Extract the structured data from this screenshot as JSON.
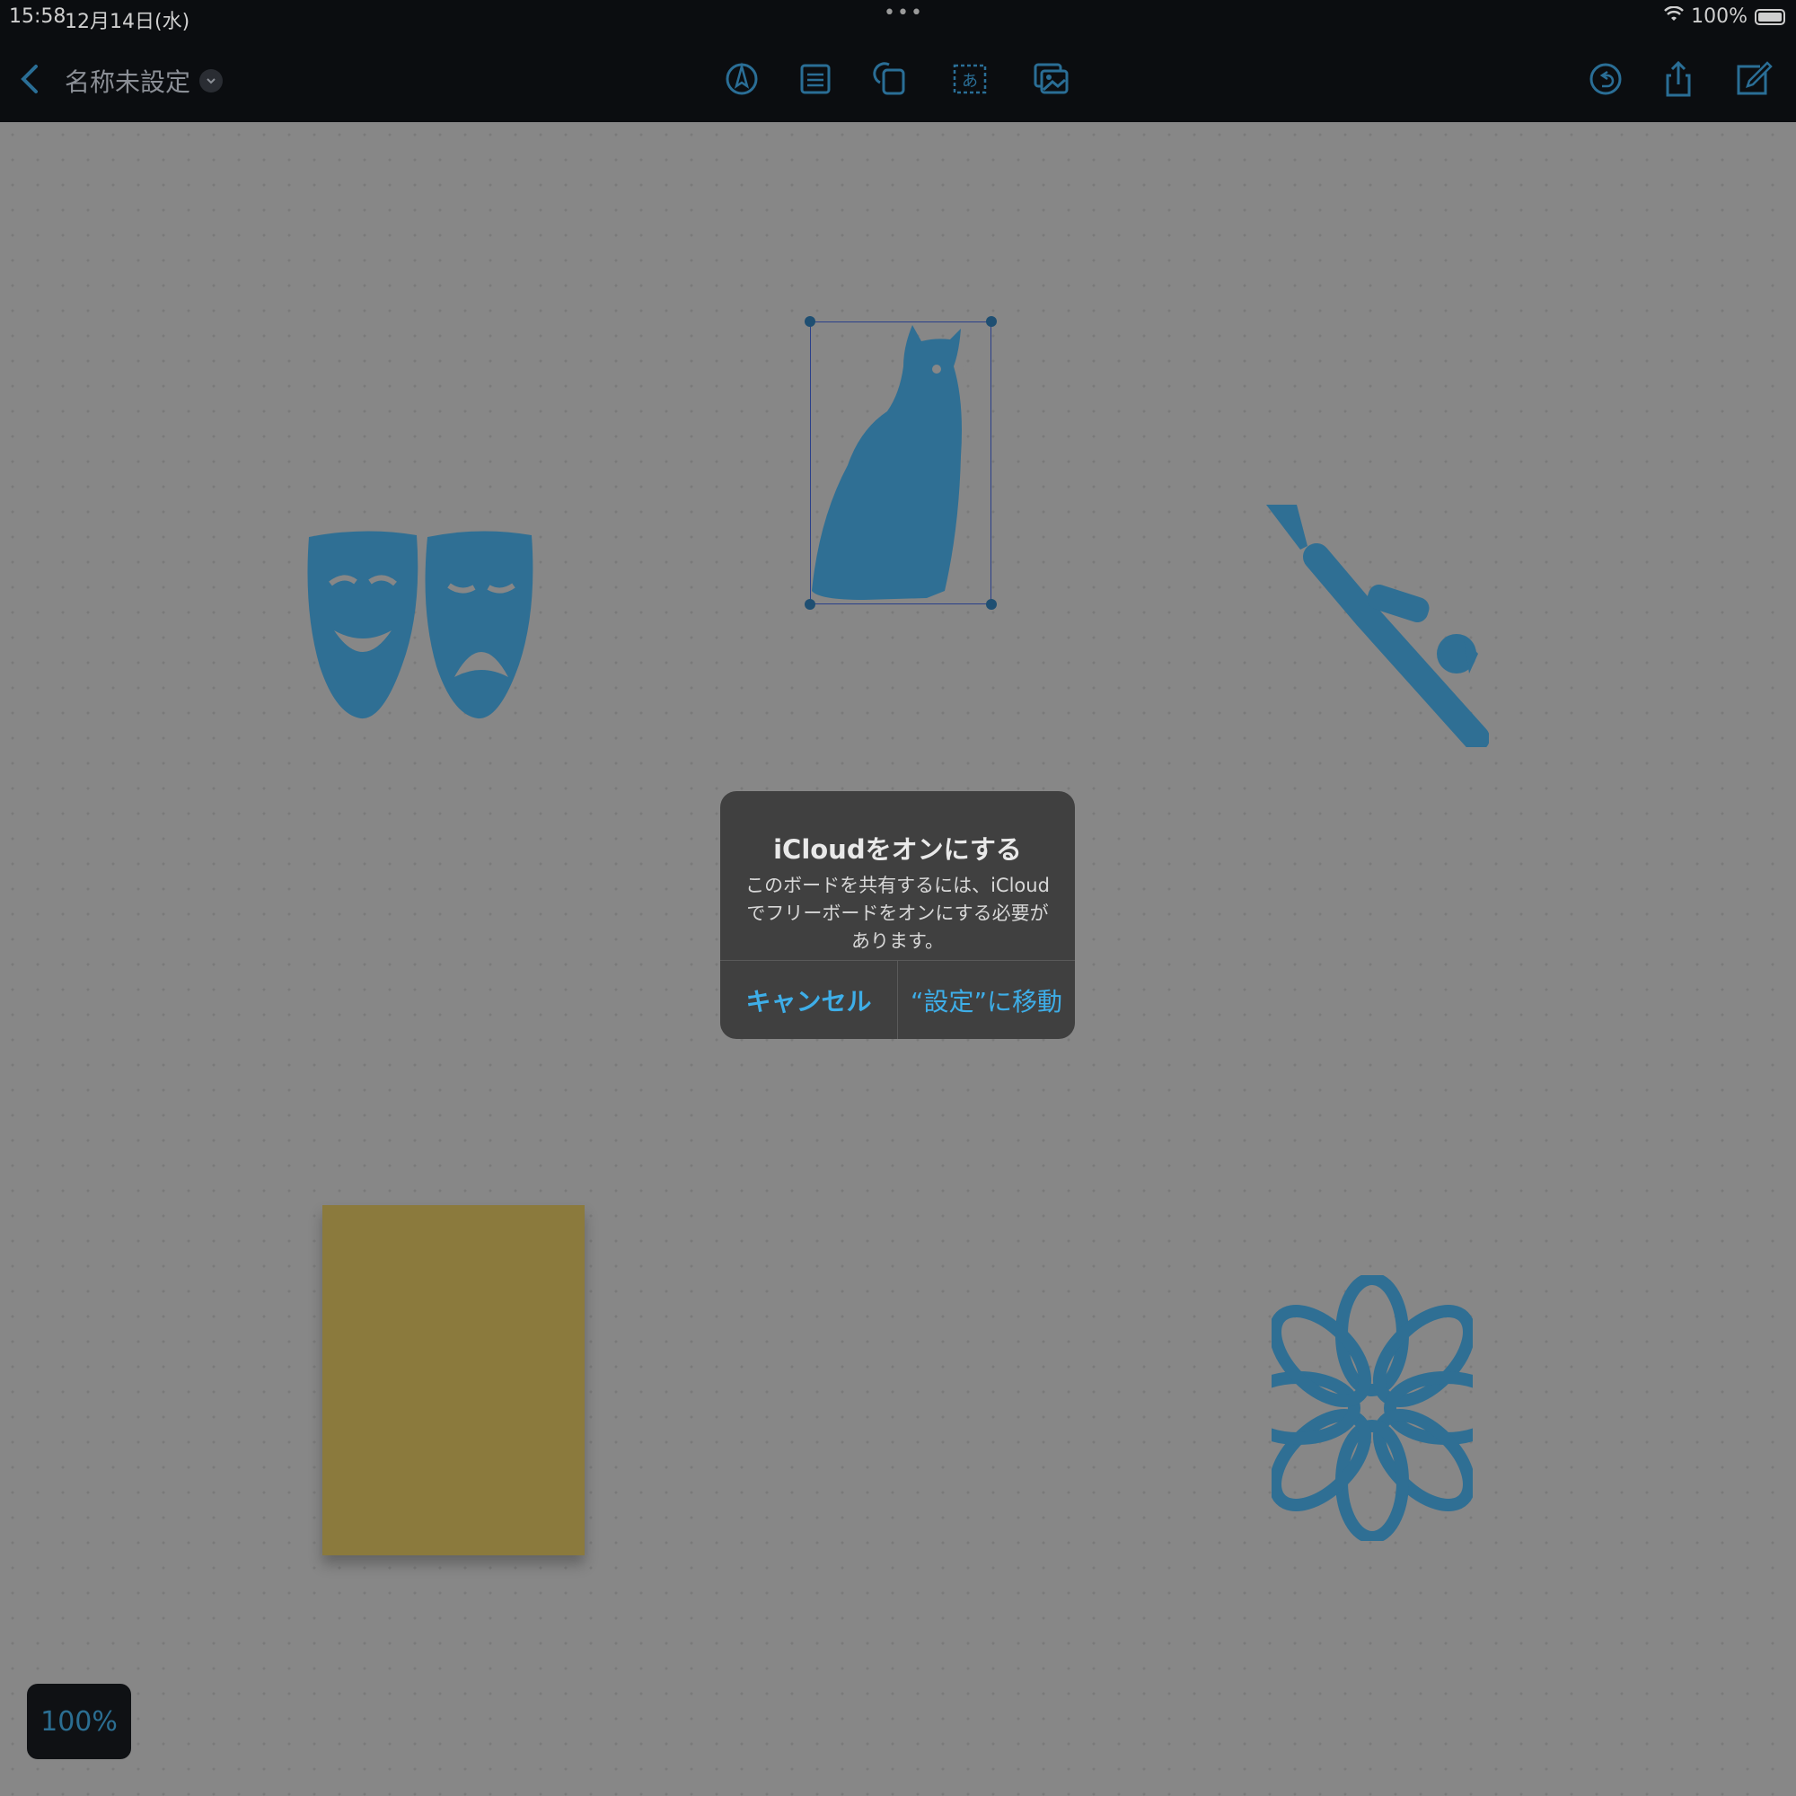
{
  "status_bar": {
    "time": "15:58",
    "date": "12月14日(水)",
    "battery": "100%",
    "multitask_dots": "•••"
  },
  "toolbar": {
    "back_icon": "chevron-left-icon",
    "title": "名称未設定",
    "tools": [
      "pen-icon",
      "sticky-note-icon",
      "shapes-icon",
      "text-box-icon",
      "image-icon"
    ],
    "right_tools": [
      "history-icon",
      "share-icon",
      "compose-icon"
    ]
  },
  "canvas": {
    "items": [
      "theater-masks",
      "owl",
      "scuba-diver",
      "sticky-note",
      "flower"
    ],
    "selected": "owl",
    "item_color": "#2f6f94",
    "sticky_color": "#8b7a3d"
  },
  "dialog": {
    "title": "iCloudをオンにする",
    "message": "このボードを共有するには、iCloudでフリーボードをオンにする必要があります。",
    "cancel_label": "キャンセル",
    "settings_label": "“設定”に移動"
  },
  "zoom": {
    "label": "100%"
  }
}
